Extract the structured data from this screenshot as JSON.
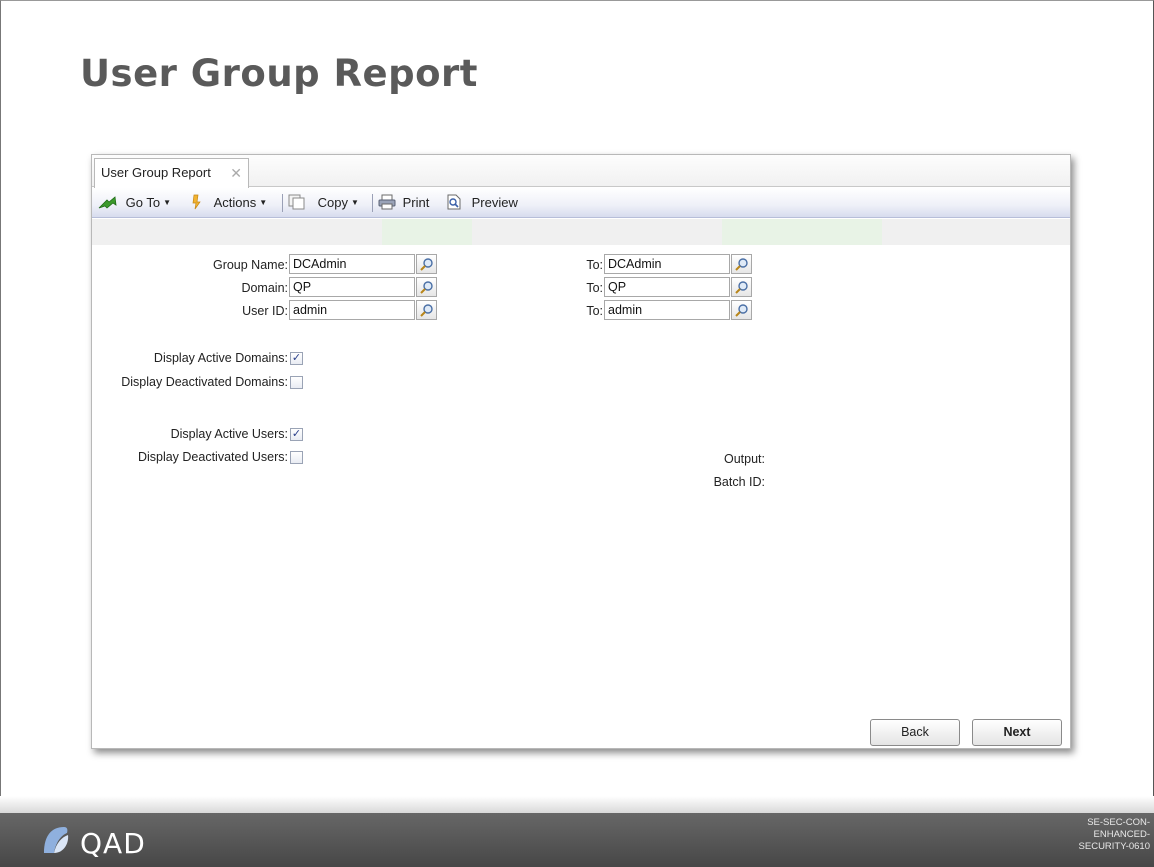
{
  "slide": {
    "title": "User Group Report"
  },
  "tab": {
    "label": "User Group Report",
    "close_glyph": "✕"
  },
  "toolbar": {
    "goto_label": "Go To",
    "actions_label": "Actions",
    "copy_label": "Copy",
    "print_label": "Print",
    "preview_label": "Preview"
  },
  "form": {
    "group_name": {
      "label": "Group Name:",
      "from": "DCAdmin",
      "to_label": "To:",
      "to": "DCAdmin"
    },
    "domain": {
      "label": "Domain:",
      "from": "QP",
      "to_label": "To:",
      "to": "QP"
    },
    "user_id": {
      "label": "User ID:",
      "from": "admin",
      "to_label": "To:",
      "to": "admin"
    },
    "display_active_domains": {
      "label": "Display Active Domains:",
      "checked": true
    },
    "display_deactivated_domains": {
      "label": "Display Deactivated Domains:",
      "checked": false
    },
    "display_active_users": {
      "label": "Display Active Users:",
      "checked": true
    },
    "display_deactivated_users": {
      "label": "Display Deactivated Users:",
      "checked": false
    },
    "output_label": "Output:",
    "batch_id_label": "Batch ID:"
  },
  "buttons": {
    "back": "Back",
    "next": "Next"
  },
  "footer": {
    "logo_text": "QAD",
    "doc_code": "SE-SEC-CON-ENHANCED-SECURITY-0610"
  }
}
